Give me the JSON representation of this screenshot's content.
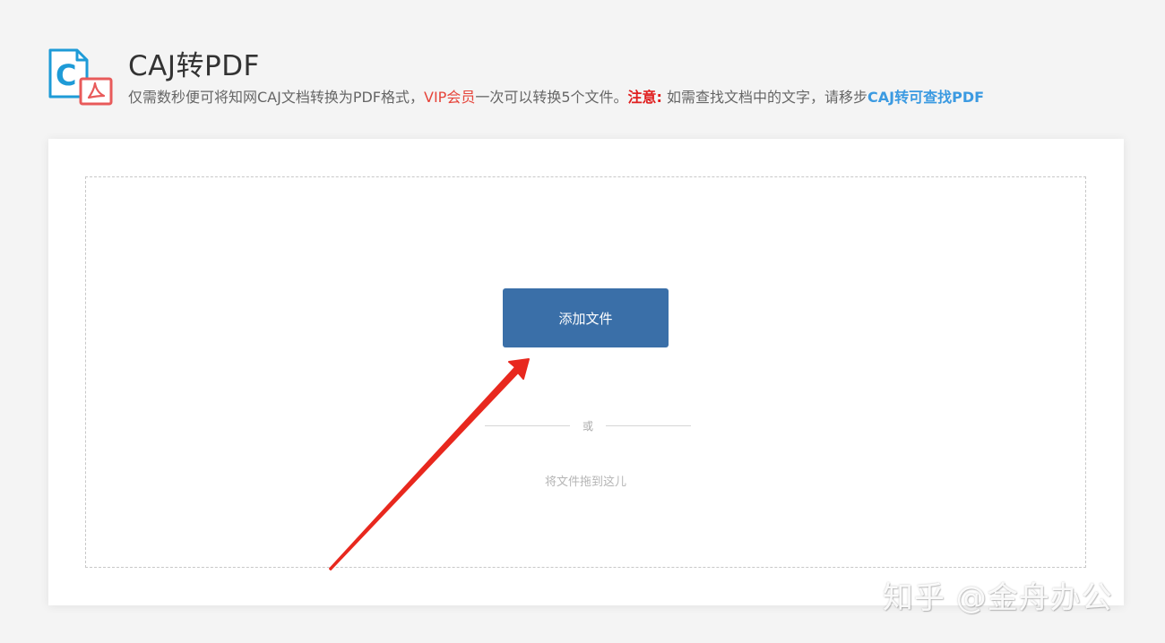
{
  "header": {
    "title": "CAJ转PDF",
    "desc_part1": "仅需数秒便可将知网CAJ文档转换为PDF格式，",
    "desc_vip": "VIP会员",
    "desc_part2": "一次可以转换5个文件。",
    "desc_notice": "注意:",
    "desc_part3": " 如需查找文档中的文字，请移步",
    "desc_link": "CAJ转可查找PDF",
    "logo_letter": "C",
    "logo_icons": [
      "caj-document-icon",
      "pdf-icon"
    ]
  },
  "upload": {
    "add_button_label": "添加文件",
    "or_label": "或",
    "drop_hint": "将文件拖到这儿"
  },
  "watermark": "知乎 @金舟办公",
  "colors": {
    "accent_blue": "#3a6fa8",
    "link_blue": "#3b9ae1",
    "vip_red": "#e6443a",
    "notice_red": "#e02020",
    "annotation_arrow": "#e8281e",
    "logo_blue": "#1e9bd7",
    "logo_pdf_red": "#e85a5a"
  }
}
